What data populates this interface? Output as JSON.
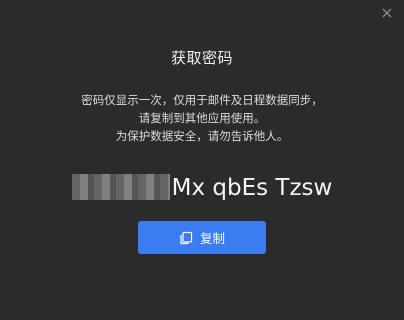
{
  "dialog": {
    "title": "获取密码",
    "description_lines": [
      "密码仅显示一次，仅用于邮件及日程数据同步，",
      "请复制到其他应用使用。",
      "为保护数据安全，请勿告诉他人。"
    ],
    "password_visible_part": "Mx qbEs Tzsw",
    "copy_button_label": "复制",
    "icons": {
      "close": "close-icon",
      "copy": "copy-icon"
    }
  },
  "colors": {
    "background": "#2b2b2b",
    "accent": "#3b7df0",
    "text": "#e6e6e6"
  }
}
